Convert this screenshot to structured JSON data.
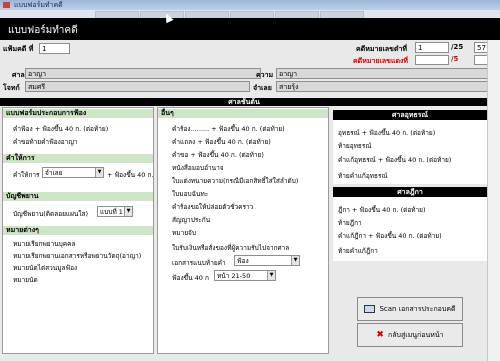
{
  "window": {
    "title": "แบบฟอร์มทำคดี"
  },
  "header": {
    "title": "แบบฟอร์มทำคดี"
  },
  "case": {
    "case_label": "แฟ้มคดี ที่",
    "case_value": "1",
    "black_no_label": "คดีหมายเลขดำที่",
    "black_no_value": "1",
    "black_sep": "/25",
    "black_year": "57",
    "red_no_label": "คดีหมายเลขแดงที่",
    "red_sep": "/5",
    "court_label": "ศาล",
    "court_value": "อาญา",
    "case_type_label": "ความ",
    "case_type_value": "อาญา",
    "plaintiff_label": "โจทก์",
    "plaintiff_value": "สมศรี",
    "defendant_label": "จำเลย",
    "defendant_value": "สายรุ้ง"
  },
  "sections": {
    "first_instance": "ศาลชั้นต้น",
    "appeal": "ศาลอุทธรณ์",
    "supreme": "ศาลฎีกา"
  },
  "left": {
    "docs_header": "แบบฟอร์มประกอบการฟ้อง",
    "docs_items": [
      "คำฟ้อง + ฟ้องขึ้น 40 ก. (ต่อท้าย)",
      "คำขอท้ายคำฟ้องอาญา"
    ],
    "testimony_header": "คำให้การ",
    "testimony_label": "คำให้การ",
    "testimony_select": "จำเลย",
    "testimony_suffix": "+ ฟ้องขึ้น 40 ก.",
    "witness_header": "บัญชีพยาน",
    "witness_label": "บัญชีพยาน(ติดลอยแผ่นใส)",
    "witness_select": "แบบที่ 1",
    "misc_header": "หมายต่างๆ",
    "misc_items": [
      "หมายเรียกพยานบุคคล",
      "หมายเรียกพยานเอกสารหรือพยานวัตถุ(อาญา)",
      "หมายนัดไต่สวนมูลฟ้อง",
      "หมายนัด"
    ]
  },
  "middle": {
    "header": "อื่นๆ",
    "items": [
      "คำร้อง......... + ฟ้องขึ้น 40 ก. (ต่อท้าย)",
      "คำแถลง + ฟ้องขึ้น 40 ก. (ต่อท้าย)",
      "คำขอ + ฟ้องขึ้น 40 ก. (ต่อท้าย)",
      "หนังสือมอบอำนาจ",
      "ใบแต่งทนายความ(กรณีมีเอกสิทธิ์ใส่ใส่ลำดับ)",
      "ใบมอบฉันทะ",
      "คำร้องขอให้ปล่อยตัวชั่วคราว",
      "สัญญาประกัน",
      "หมายจับ",
      "ใบรับเงินหรือสั่งของที่ผู้ความรับไปจากศาล"
    ],
    "doc_type_label": "เอกสารแนบท้ายคำ",
    "doc_type_select": "ฟ้อง",
    "form_label": "ฟ้องขึ้น 40 ก",
    "form_select": "หน้า 21-50"
  },
  "appeal": {
    "items": [
      "อุทธรณ์ + ฟ้องขึ้น 40 ก. (ต่อท้าย)",
      "ท้ายอุทธรณ์",
      "คำแก้อุทธรณ์ + ฟ้องขึ้น 40 ก. (ต่อท้าย)",
      "ท้ายคำแก้อุทธรณ์"
    ]
  },
  "supreme": {
    "items": [
      "ฎีกา + ฟ้องขึ้น 40 ก. (ต่อท้าย)",
      "ท้ายฎีกา",
      "คำแก้ฎีกา + ฟ้องขึ้น 40 ก. (ต่อท้าย)",
      "ท้ายคำแก้ฎีกา"
    ]
  },
  "actions": {
    "scan": "Scan เอกสารประกอบคดี",
    "back": "กลับสู่เมนูก่อนหน้า"
  }
}
